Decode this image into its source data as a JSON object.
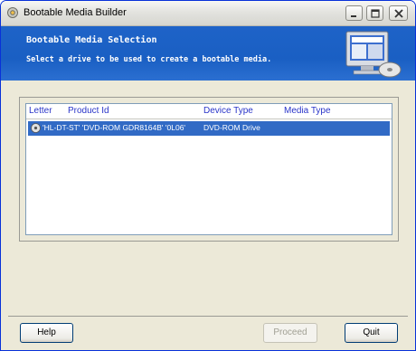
{
  "window": {
    "title": "Bootable Media Builder"
  },
  "header": {
    "title": "Bootable Media Selection",
    "subtitle": "Select a drive to be used to create a bootable media."
  },
  "list": {
    "columns": [
      "Letter",
      "Product Id",
      "Device Type",
      "Media Type"
    ],
    "rows": [
      {
        "letter": "",
        "product_id": "'HL-DT-ST' 'DVD-ROM GDR8164B' '0L06'",
        "device_type": "DVD-ROM Drive",
        "media_type": ""
      }
    ]
  },
  "buttons": {
    "help": "Help",
    "proceed": "Proceed",
    "quit": "Quit"
  },
  "colors": {
    "header_bg": "#1e63c8",
    "selection": "#316ac5",
    "column_text": "#2a35c9"
  }
}
